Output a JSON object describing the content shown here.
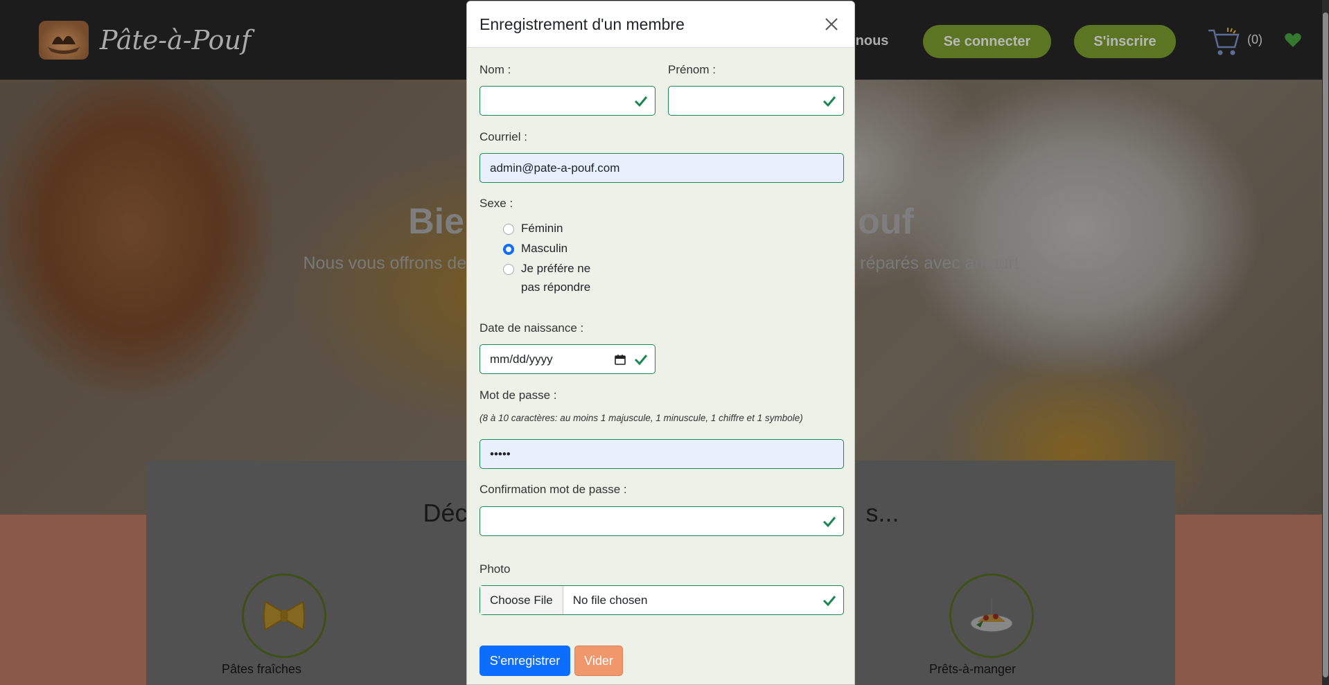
{
  "colors": {
    "brand_green": "#6b8a2a",
    "valid_green": "#198754",
    "primary_blue": "#0d6efd",
    "reset_orange": "#f0976b",
    "salmon": "#f09a7d"
  },
  "navbar": {
    "logo_text": "Pâte-à-Pouf",
    "link_partial": "z-nous",
    "login_button": "Se connecter",
    "signup_button": "S'inscrire",
    "cart_count": "(0)",
    "icons": [
      "cart-icon",
      "heart-icon"
    ]
  },
  "hero": {
    "title_left": "Bie",
    "title_right": "ouf",
    "subtitle_left": "Nous vous offrons de",
    "subtitle_right": "réparés avec amour!"
  },
  "section": {
    "title_left": "Déc",
    "title_right": "s...",
    "categories": [
      {
        "label": "Pâtes fraîches",
        "icon": "farfalle-icon"
      },
      {
        "label": "Prêts-à-manger",
        "icon": "pasta-dish-icon"
      }
    ]
  },
  "modal": {
    "title": "Enregistrement d'un membre",
    "nom_label": "Nom :",
    "nom_value": "",
    "prenom_label": "Prénom :",
    "prenom_value": "",
    "courriel_label": "Courriel :",
    "courriel_value": "admin@pate-a-pouf.com",
    "sexe_label": "Sexe :",
    "sexe_options": [
      {
        "label": "Féminin",
        "selected": false
      },
      {
        "label": "Masculin",
        "selected": true
      },
      {
        "label": "Je préfére ne pas répondre",
        "selected": false
      }
    ],
    "sexe_option3_line1": "Je préfére ne",
    "sexe_option3_line2": "pas répondre",
    "naissance_label": "Date de naissance :",
    "naissance_placeholder": "mm/dd/yyyy",
    "mdp_label": "Mot de passe :",
    "mdp_hint": "(8 à 10 caractères: au moins 1 majuscule, 1 minuscule, 1 chiffre et 1 symbole)",
    "mdp_value": "•••••",
    "confirm_label": "Confirmation mot de passe :",
    "confirm_value": "",
    "photo_label": "Photo",
    "photo_button": "Choose File",
    "photo_status": "No file chosen",
    "submit_button": "S'enregistrer",
    "reset_button": "Vider"
  }
}
